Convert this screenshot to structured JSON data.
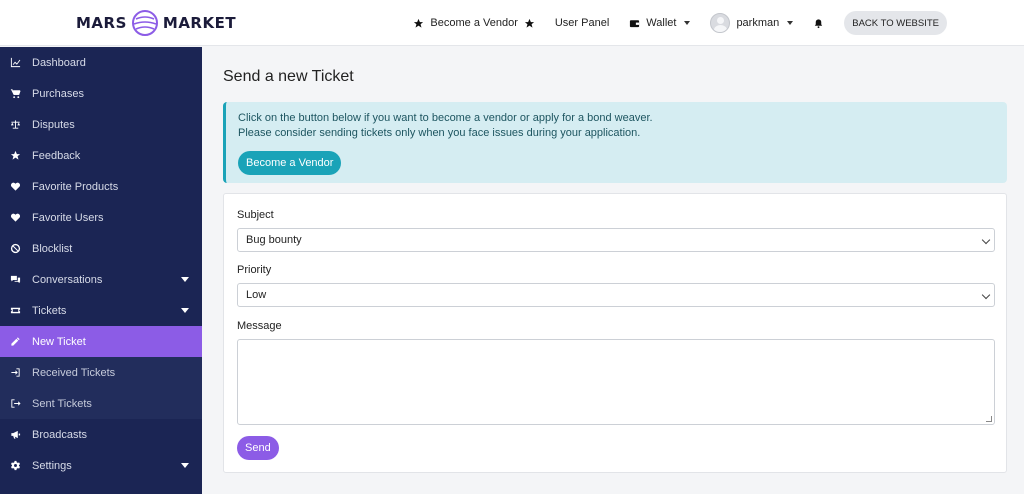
{
  "brand": {
    "left": "MARS",
    "right": "MARKET"
  },
  "topnav": {
    "become_vendor": "Become a Vendor",
    "user_panel": "User Panel",
    "wallet": "Wallet",
    "username": "parkman",
    "back": "BACK TO WEBSITE"
  },
  "sidebar": {
    "items": [
      {
        "label": "Dashboard",
        "icon": "chart-line-icon"
      },
      {
        "label": "Purchases",
        "icon": "cart-icon"
      },
      {
        "label": "Disputes",
        "icon": "scale-icon"
      },
      {
        "label": "Feedback",
        "icon": "star-icon"
      },
      {
        "label": "Favorite Products",
        "icon": "heart-icon"
      },
      {
        "label": "Favorite Users",
        "icon": "heart-icon"
      },
      {
        "label": "Blocklist",
        "icon": "ban-icon"
      },
      {
        "label": "Conversations",
        "icon": "comments-icon"
      },
      {
        "label": "Tickets",
        "icon": "ticket-icon"
      },
      {
        "label": "New Ticket",
        "icon": "pencil-icon"
      },
      {
        "label": "Received Tickets",
        "icon": "sign-in-icon"
      },
      {
        "label": "Sent Tickets",
        "icon": "sign-out-icon"
      },
      {
        "label": "Broadcasts",
        "icon": "megaphone-icon"
      },
      {
        "label": "Settings",
        "icon": "gear-icon"
      }
    ]
  },
  "main": {
    "title": "Send a new Ticket",
    "alert": {
      "line1": "Click on the button below if you want to become a vendor or apply for a bond weaver.",
      "line2": "Please consider sending tickets only when you face issues during your application.",
      "button": "Become a Vendor"
    },
    "form": {
      "subject_label": "Subject",
      "subject_value": "Bug bounty",
      "priority_label": "Priority",
      "priority_value": "Low",
      "message_label": "Message",
      "message_value": "",
      "send": "Send"
    }
  },
  "colors": {
    "sidebar": "#1b2554",
    "accent": "#8c5ce6",
    "info": "#1aa3b8"
  }
}
